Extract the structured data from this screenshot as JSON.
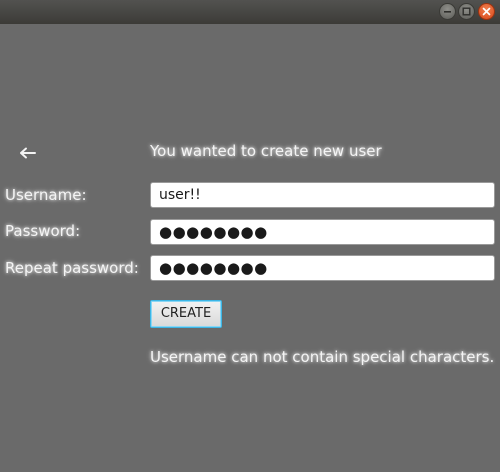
{
  "window": {
    "controls": [
      "minimize-icon",
      "maximize-icon",
      "close-icon"
    ]
  },
  "page": {
    "back_icon": "back-arrow-icon",
    "heading": "You wanted to create new user"
  },
  "form": {
    "username_label": "Username:",
    "username_value": "user!!",
    "password_label": "Password:",
    "password_value": "●●●●●●●●",
    "repeat_label": "Repeat password:",
    "repeat_value": "●●●●●●●●",
    "create_label": "CREATE"
  },
  "status": {
    "error_message": "Username can not contain special characters."
  },
  "colors": {
    "background": "#6a6a6a",
    "text": "#f4f4f4",
    "focus_border": "#3cb6e6",
    "close_button": "#e05a24"
  }
}
